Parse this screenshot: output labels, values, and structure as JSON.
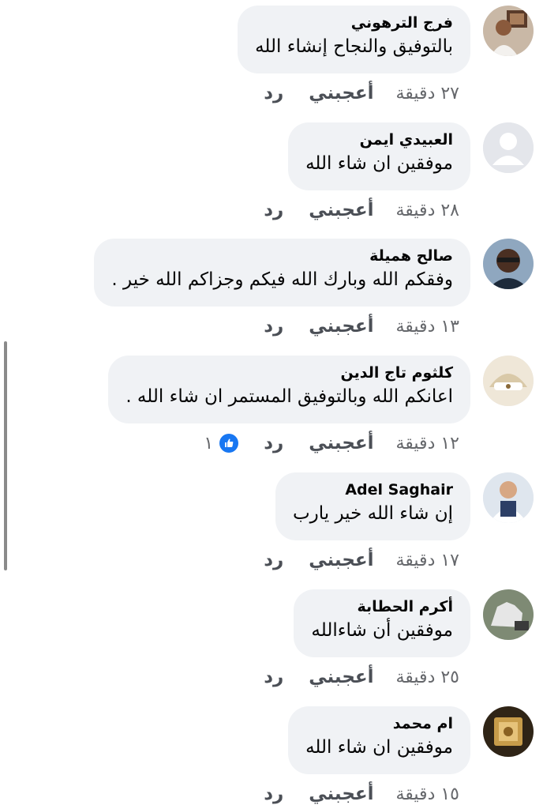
{
  "comments": [
    {
      "author": "فرج الترهوني",
      "text": "بالتوفيق والنجاح إنشاء الله",
      "time": "٢٧ دقيقة",
      "like": "أعجبني",
      "reply": "رد",
      "avatar": "avatar-boy-icon"
    },
    {
      "author": "العبيدي ايمن",
      "text": "موفقين ان شاء الله",
      "time": "٢٨ دقيقة",
      "like": "أعجبني",
      "reply": "رد",
      "avatar": "default-user-icon"
    },
    {
      "author": "صالح هميلة",
      "text": "وفقكم الله وبارك الله فيكم وجزاكم الله خير .",
      "time": "١٣ دقيقة",
      "like": "أعجبني",
      "reply": "رد",
      "avatar": "avatar-man-icon"
    },
    {
      "author": "كلثوم تاج الدين",
      "text": "اعانكم الله وبالتوفيق المستمر ان شاء الله .",
      "time": "١٢ دقيقة",
      "like": "أعجبني",
      "reply": "رد",
      "avatar": "avatar-logo-icon",
      "reactions": "١",
      "reaction_icon": "like-thumb-icon",
      "reaction_color": "#1877f2"
    },
    {
      "author": "Adel Saghair",
      "text": "إن شاء الله خير يارب",
      "time": "١٧ دقيقة",
      "like": "أعجبني",
      "reply": "رد",
      "avatar": "avatar-child-icon"
    },
    {
      "author": "أكرم الحطابة",
      "text": "موفقين أن شاءالله",
      "time": "٢٥ دقيقة",
      "like": "أعجبني",
      "reply": "رد",
      "avatar": "avatar-horse-icon"
    },
    {
      "author": "ام محمد",
      "text": "موفقين ان شاء الله",
      "time": "١٥ دقيقة",
      "like": "أعجبني",
      "reply": "رد",
      "avatar": "avatar-book-icon"
    }
  ],
  "colors": {
    "bubble": "#f0f2f5",
    "name": "#050505",
    "meta": "#65676b",
    "action": "#4b4f56",
    "accent": "#1877f2"
  }
}
